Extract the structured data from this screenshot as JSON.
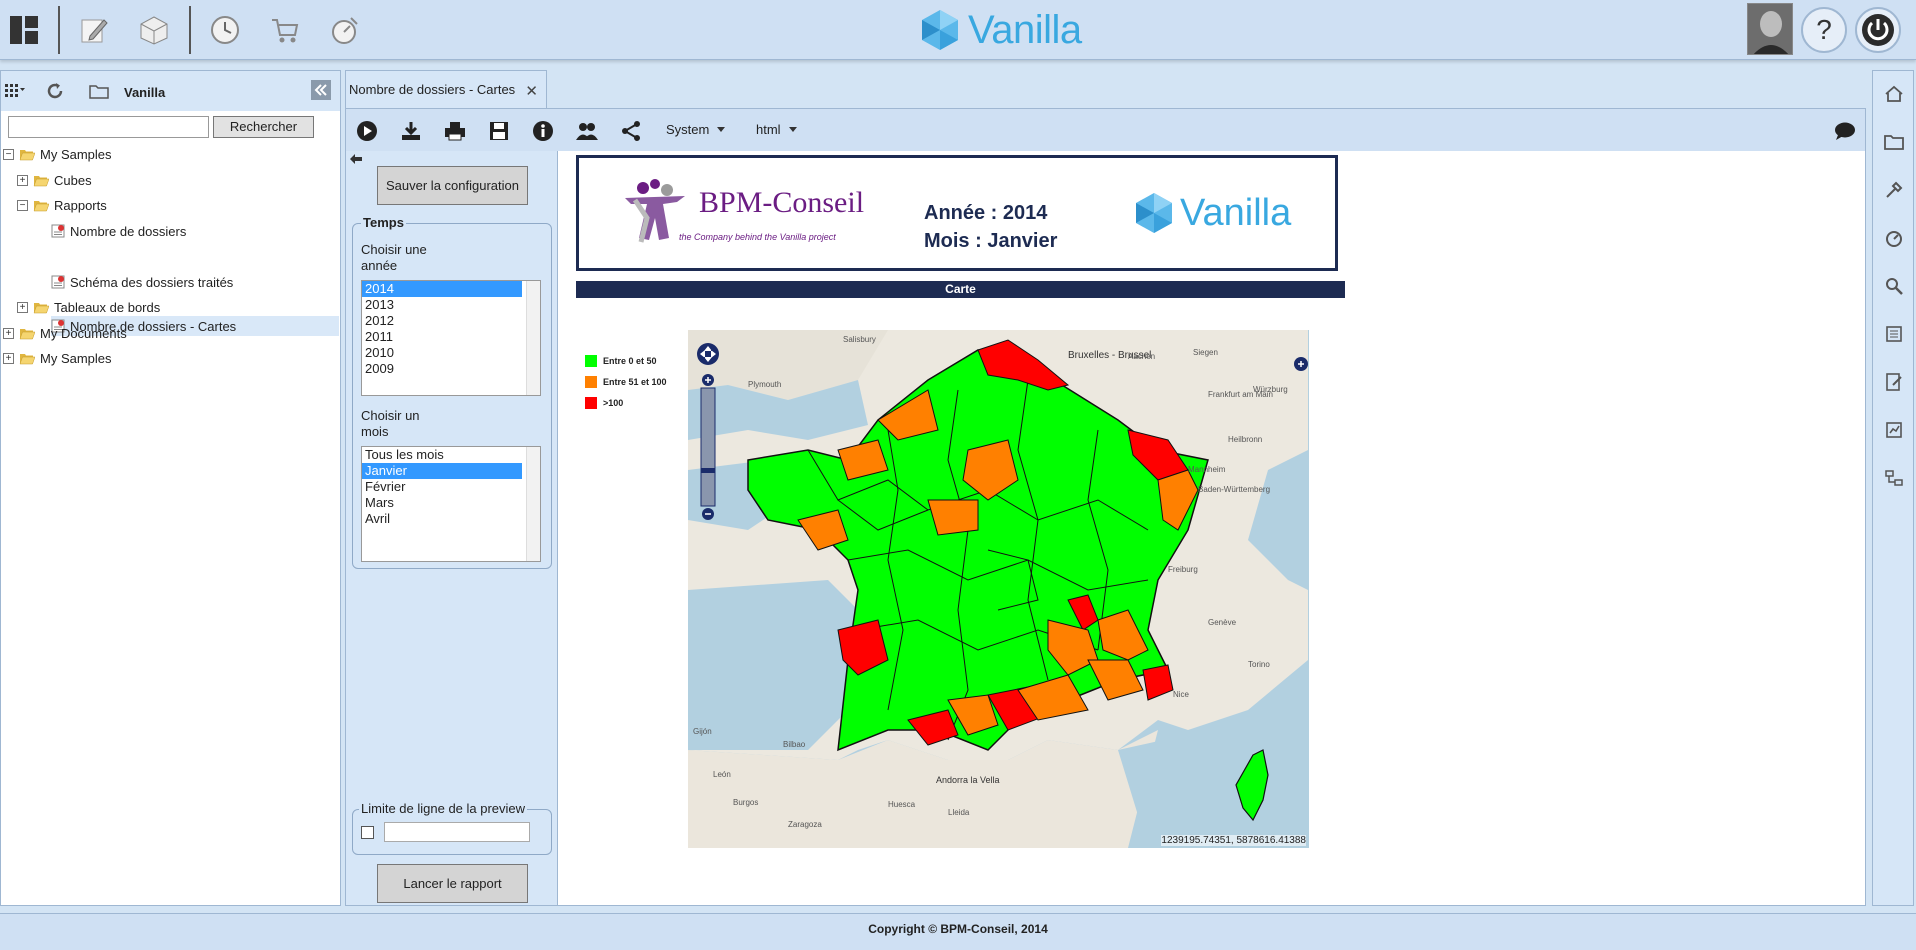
{
  "app": {
    "brand": "Vanilla"
  },
  "topbar": {
    "icons": [
      "dashboard-icon",
      "edit-icon",
      "cube-icon",
      "clock-icon",
      "cart-icon",
      "timer-icon"
    ],
    "help_label": "?"
  },
  "left_panel": {
    "title": "Vanilla",
    "search_placeholder": "",
    "search_button": "Rechercher",
    "tree": [
      {
        "label": "My Samples",
        "level": 0,
        "expanded": true
      },
      {
        "label": "Cubes",
        "level": 1,
        "expanded": false
      },
      {
        "label": "Rapports",
        "level": 1,
        "expanded": true
      },
      {
        "label": "Nombre de dossiers",
        "level": 2
      },
      {
        "label": "Nombre de dossiers - Cartes",
        "level": 2,
        "selected": true
      },
      {
        "label": "Schéma des dossiers traités",
        "level": 2
      },
      {
        "label": "Tableaux de bords",
        "level": 1,
        "expanded": false
      },
      {
        "label": "My Documents",
        "level": 0,
        "expanded": false
      },
      {
        "label": "My Samples",
        "level": 0,
        "expanded": false
      }
    ]
  },
  "tab": {
    "label": "Nombre de dossiers - Cartes"
  },
  "toolbar": {
    "system_label": "System",
    "format_label": "html"
  },
  "params": {
    "save_config": "Sauver la configuration",
    "group_title": "Temps",
    "year_label": "Choisir une année",
    "years": [
      "2014",
      "2013",
      "2012",
      "2011",
      "2010",
      "2009"
    ],
    "selected_year": "2014",
    "month_label": "Choisir un mois",
    "months": [
      "Tous les mois",
      "Janvier",
      "Février",
      "Mars",
      "Avril"
    ],
    "selected_month": "Janvier",
    "preview_title": "Limite de ligne de la preview",
    "preview_value": "",
    "run_button": "Lancer le rapport"
  },
  "report": {
    "company": "BPM-Conseil",
    "company_tagline": "the Company behind the Vanilla project",
    "year_line": "Année : 2014",
    "month_line": "Mois : Janvier",
    "vanilla_logo": "Vanilla",
    "section_title": "Carte",
    "legend": [
      {
        "label": "Entre 0 et 50",
        "color": "#00ff00"
      },
      {
        "label": "Entre 51 et 100",
        "color": "#ff8000"
      },
      {
        "label": ">100",
        "color": "#ff0000"
      }
    ],
    "map_coordinates": "1239195.74351, 5878616.41388",
    "map_places": [
      "Bruxelles - Brussel",
      "Salisbury",
      "Plymouth",
      "Andorra la Vella",
      "Genève",
      "Torino",
      "Heilbronn",
      "Würzburg",
      "Aachen",
      "Siegen",
      "Frankfurt am Main",
      "Mannheim",
      "Baden-Württemberg",
      "Freiburg",
      "Nice",
      "Zaragoza",
      "Huesca",
      "Lleida",
      "León",
      "Burgos",
      "Gijón",
      "Bilbao"
    ]
  },
  "footer": {
    "text": "Copyright © BPM-Conseil, 2014"
  }
}
